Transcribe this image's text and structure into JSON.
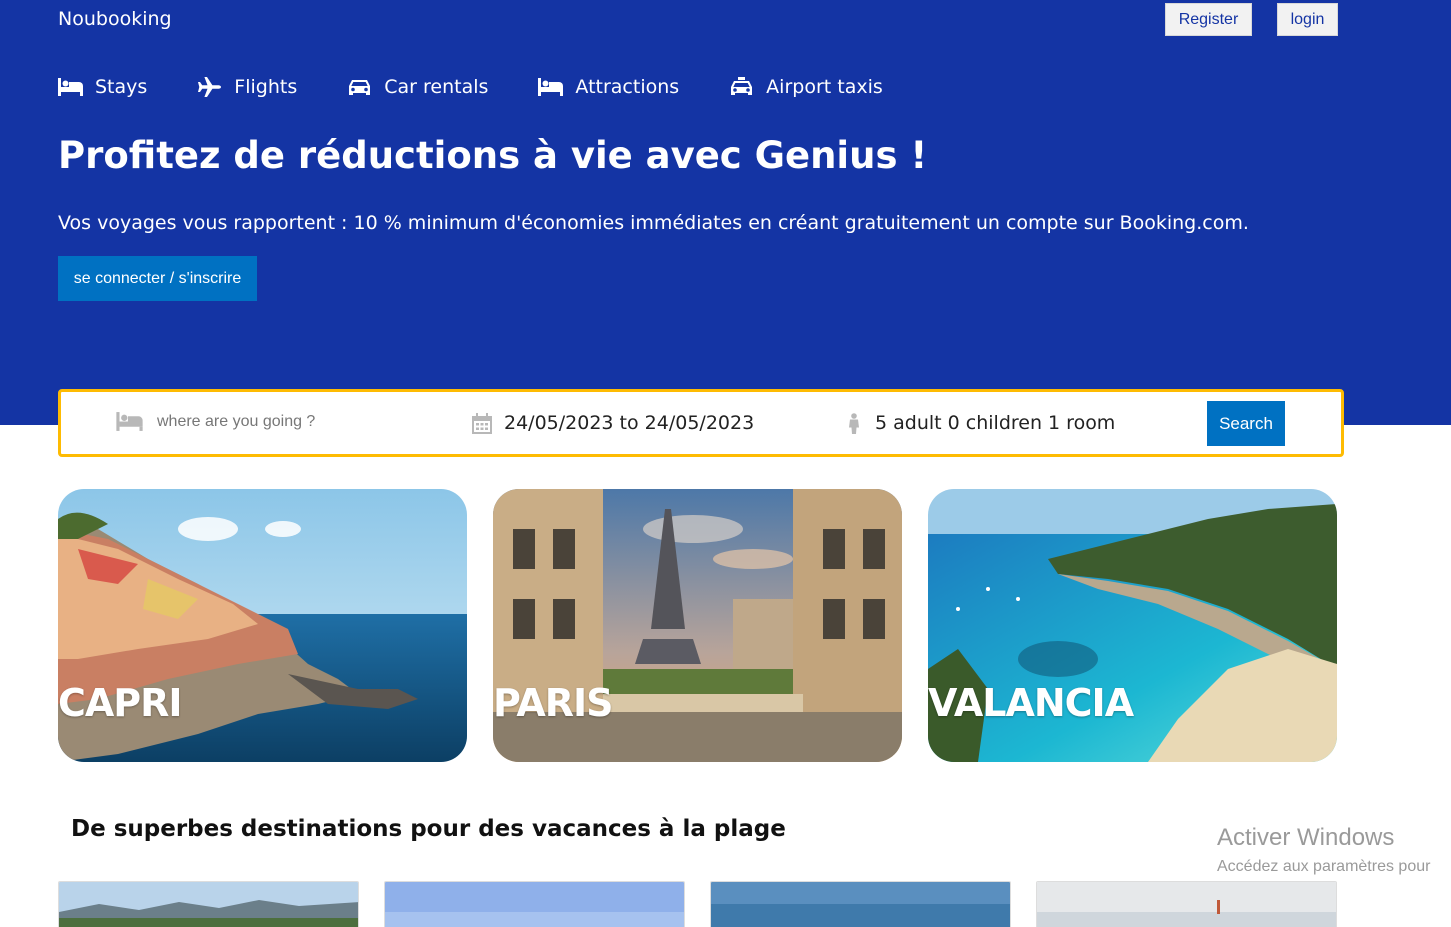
{
  "brand": "Noubooking",
  "auth": {
    "register_label": "Register",
    "login_label": "login"
  },
  "nav": [
    {
      "label": "Stays",
      "icon": "bed-icon"
    },
    {
      "label": "Flights",
      "icon": "plane-icon"
    },
    {
      "label": "Car rentals",
      "icon": "car-icon"
    },
    {
      "label": "Attractions",
      "icon": "bed-icon"
    },
    {
      "label": "Airport taxis",
      "icon": "taxi-icon"
    }
  ],
  "hero": {
    "title": "Profitez de réductions à vie avec Genius !",
    "subtitle": "Vos voyages vous rapportent : 10 % minimum d'économies immédiates en créant gratuitement un compte sur Booking.com.",
    "cta_label": "se connecter / s'inscrire"
  },
  "search": {
    "destination_placeholder": "where are you going ?",
    "destination_value": "",
    "dates": "24/05/2023 to 24/05/2023",
    "guests": "5 adult 0 children 1 room",
    "button_label": "Search"
  },
  "destinations": [
    {
      "name": "CAPRI"
    },
    {
      "name": "PARIS"
    },
    {
      "name": "VALANCIA"
    }
  ],
  "beach_section": {
    "title": "De superbes destinations pour des vacances à la plage"
  },
  "watermark": {
    "title": "Activer Windows",
    "subtitle": "Accédez aux paramètres pour"
  },
  "colors": {
    "hero_bg": "#1434a4",
    "accent_blue": "#0071c2",
    "search_border": "#febb02"
  }
}
